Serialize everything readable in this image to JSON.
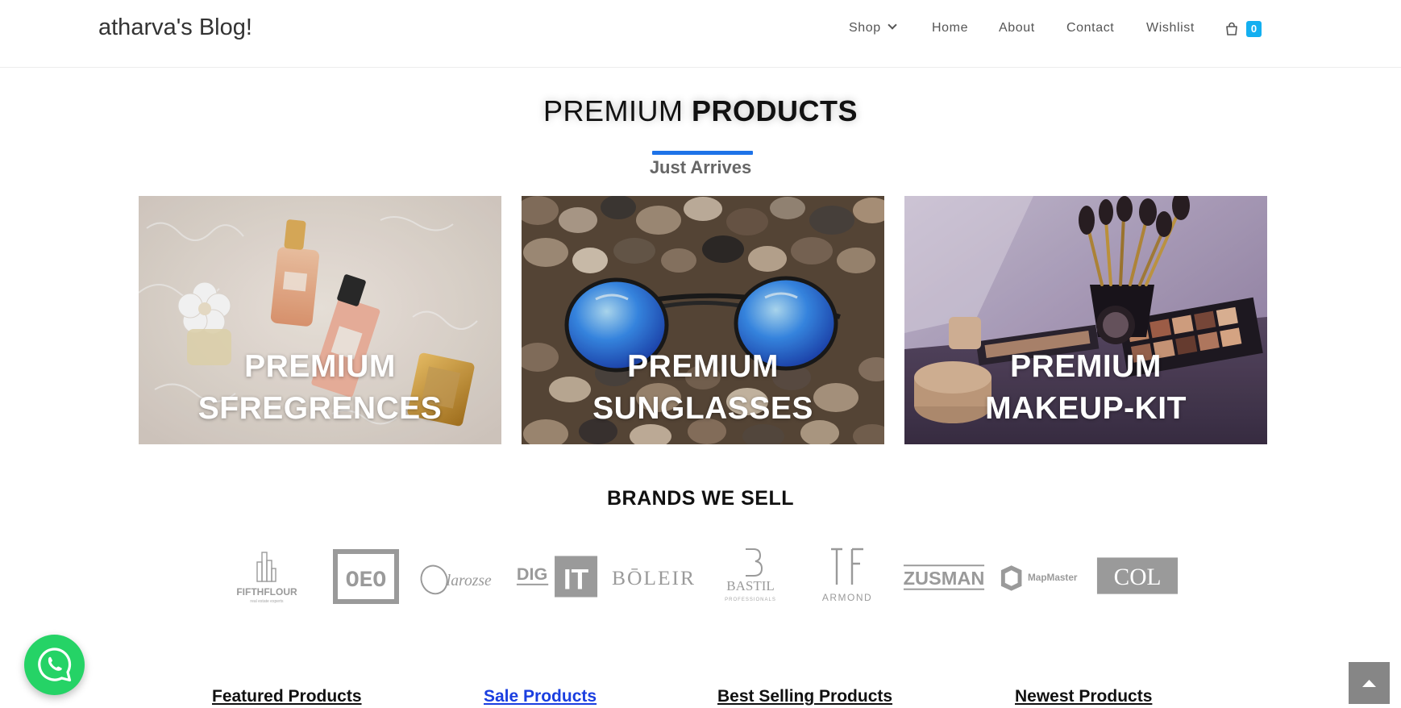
{
  "header": {
    "brand": "atharva's Blog!",
    "nav": [
      {
        "label": "Shop",
        "has_dropdown": true
      },
      {
        "label": "Home"
      },
      {
        "label": "About"
      },
      {
        "label": "Contact"
      },
      {
        "label": "Wishlist"
      }
    ],
    "cart_icon": "shopping-bag-icon",
    "cart_count": "0",
    "accent_color": "#13aff0"
  },
  "section": {
    "title_light": "PREMIUM ",
    "title_bold": "PRODUCTS",
    "subtitle": "Just Arrives",
    "accent_color": "#1e73e8"
  },
  "cards": [
    {
      "line1": "PREMIUM",
      "line2": "SFREGRENCES",
      "image": "perfume-bottles-on-fur"
    },
    {
      "line1": "PREMIUM",
      "line2": "SUNGLASSES",
      "image": "sunglasses-on-pebbles"
    },
    {
      "line1": "PREMIUM",
      "line2": "MAKEUP-KIT",
      "image": "makeup-brushes-and-palettes"
    }
  ],
  "brands": {
    "title": "BRANDS WE SELL",
    "logos": [
      {
        "name": "FIFTHFLOUR",
        "tagline": "real estate experts"
      },
      {
        "name": "OEO"
      },
      {
        "name": "larozse"
      },
      {
        "name": "DIG",
        "name2": "IT"
      },
      {
        "name": "BŌLEIR"
      },
      {
        "name": "BASTIL",
        "tagline": "PROFESSIONALS"
      },
      {
        "name": "ARMOND"
      },
      {
        "name": "ZUSMAN"
      },
      {
        "name": "MapMaster"
      },
      {
        "name": "COL"
      }
    ]
  },
  "tabs": [
    {
      "label": "Featured Products",
      "active": false
    },
    {
      "label": "Sale Products",
      "active": true
    },
    {
      "label": "Best Selling Products",
      "active": false
    },
    {
      "label": "Newest Products",
      "active": false
    }
  ],
  "floating": {
    "whatsapp_icon": "whatsapp-icon",
    "whatsapp_color": "#25d366",
    "scroll_top_icon": "chevron-up-icon"
  }
}
